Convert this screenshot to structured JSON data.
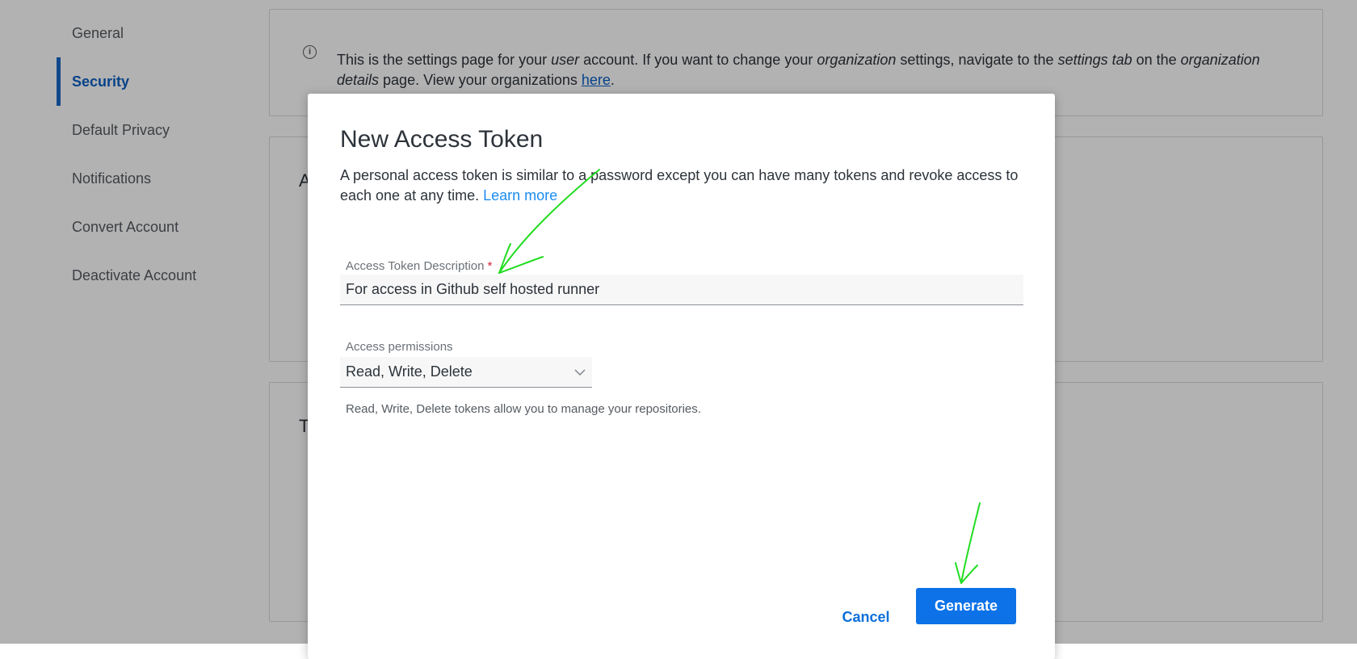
{
  "sidebar": {
    "items": [
      {
        "label": "General"
      },
      {
        "label": "Security",
        "active": true
      },
      {
        "label": "Default Privacy"
      },
      {
        "label": "Notifications"
      },
      {
        "label": "Convert Account"
      },
      {
        "label": "Deactivate Account"
      }
    ]
  },
  "info": {
    "icon": "info-icon",
    "t1": "This is the settings page for your ",
    "t2": "user",
    "t3": " account. If you want to change your ",
    "t4": "organization",
    "t5": " settings, navigate to the ",
    "t6": "settings tab",
    "t7": " on the ",
    "t8": "organization details",
    "t9": " page. View your organizations ",
    "link": "here",
    "t10": "."
  },
  "cards": {
    "card2_initial": "A",
    "card3_initial": "T"
  },
  "modal": {
    "title": "New Access Token",
    "description": "A personal access token is similar to a password except you can have many tokens and revoke access to each one at any time. ",
    "learn_more": "Learn more",
    "description_label": "Access Token Description",
    "required_mark": "*",
    "description_value": "For access in Github self hosted runner",
    "permissions_label": "Access permissions",
    "permissions_value": "Read, Write, Delete",
    "helper": "Read, Write, Delete tokens allow you to manage your repositories.",
    "cancel_label": "Cancel",
    "generate_label": "Generate"
  },
  "colors": {
    "accent": "#0d72e8",
    "sidebar_active": "#0b5fc5",
    "annotation": "#22dd22"
  }
}
